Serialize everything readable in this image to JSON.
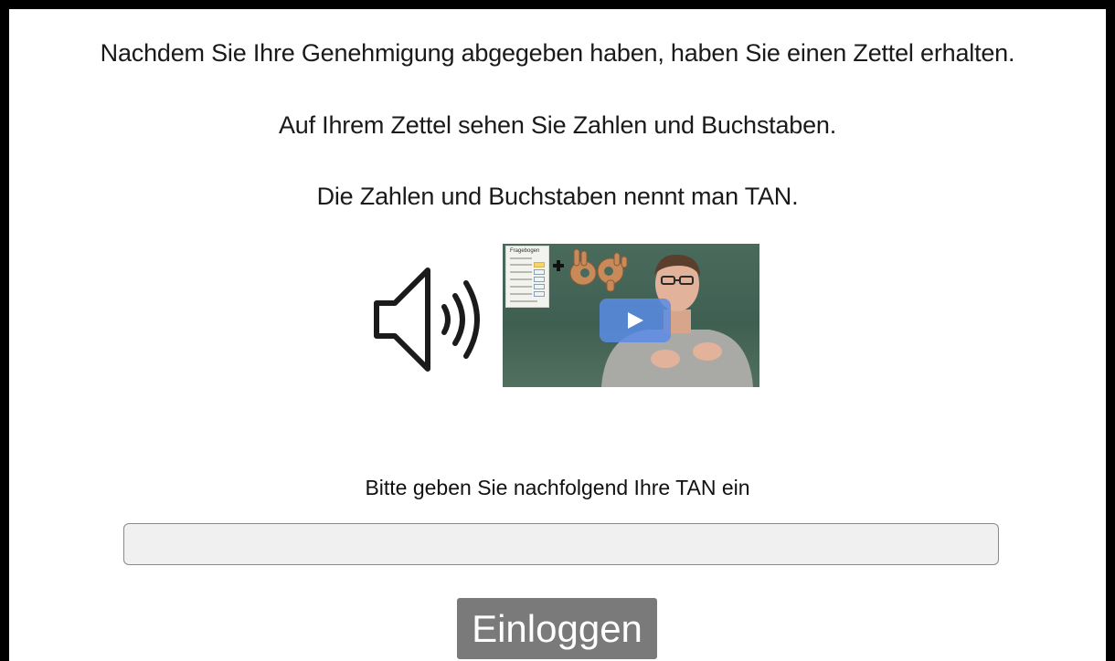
{
  "intro": {
    "line1": "Nachdem Sie Ihre Genehmigung abgegeben haben, haben Sie einen Zettel erhalten.",
    "line2": "Auf Ihrem Zettel sehen Sie Zahlen und Buchstaben.",
    "line3": "Die Zahlen und Buchstaben nennt man TAN."
  },
  "media": {
    "audio_icon": "speaker-icon",
    "video_thumbnail_sheet_title": "Fragebogen",
    "play_icon": "play-icon"
  },
  "login": {
    "prompt": "Bitte geben Sie nachfolgend Ihre TAN ein",
    "tan_value": "",
    "tan_placeholder": "",
    "button_label": "Einloggen"
  },
  "colors": {
    "frame": "#000000",
    "button_bg": "#7a7a7a",
    "input_bg": "#f0f0f0",
    "play_button": "#5a8ce6"
  }
}
